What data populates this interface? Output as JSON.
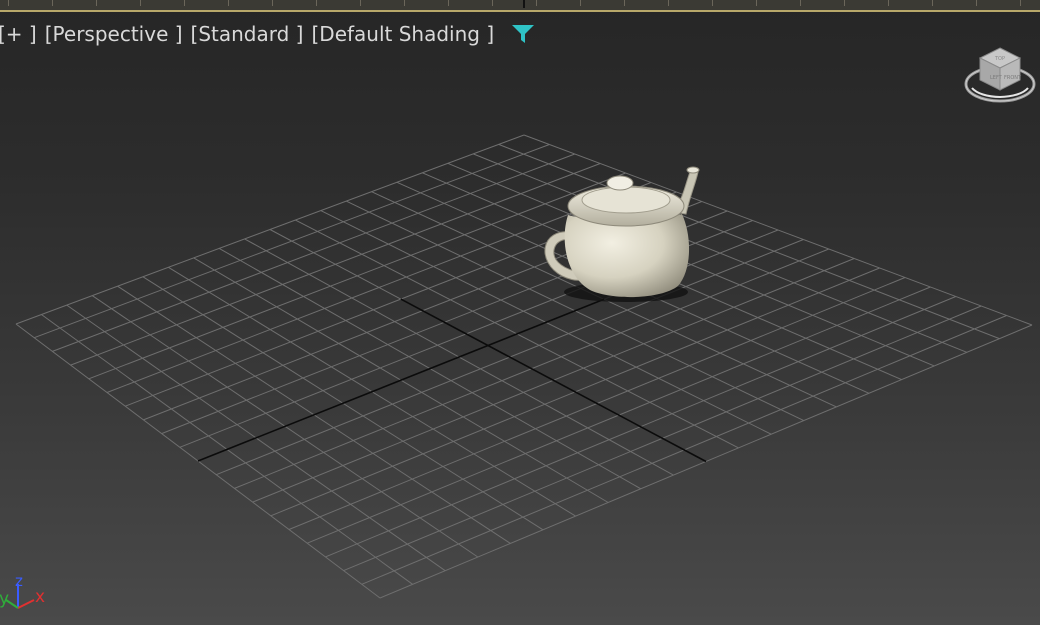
{
  "viewport": {
    "labels": {
      "plus": "[+ ]",
      "view": "[Perspective ]",
      "shading_style": "[Standard ]",
      "shading_mode": "[Default Shading ]"
    },
    "filter_icon": "filter-icon",
    "viewcube": {
      "top_label": "TOP",
      "front_label": "FRONT",
      "left_label": "LEFT"
    },
    "axis": {
      "x": "x",
      "y": "y",
      "z": "z"
    },
    "scene_object": "teapot"
  },
  "colors": {
    "grid_line": "#6e6e6e",
    "grid_axis": "#0b0b0b",
    "teapot": "#d8d5c5",
    "filter_icon": "#2fc3c6",
    "axis_x": "#e03030",
    "axis_y": "#2fae3a",
    "axis_z": "#3a5cff",
    "label_text": "#d9d9d9"
  }
}
